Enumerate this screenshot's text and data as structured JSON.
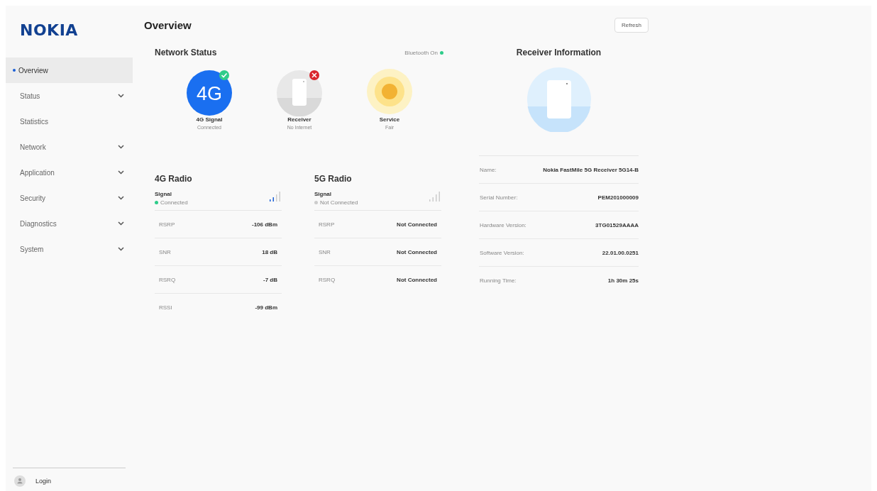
{
  "logo": "NOKIA",
  "sidebar": {
    "items": [
      {
        "label": "Overview",
        "selected": true,
        "expandable": false
      },
      {
        "label": "Status",
        "selected": false,
        "expandable": true
      },
      {
        "label": "Statistics",
        "selected": false,
        "expandable": false
      },
      {
        "label": "Network",
        "selected": false,
        "expandable": true
      },
      {
        "label": "Application",
        "selected": false,
        "expandable": true
      },
      {
        "label": "Security",
        "selected": false,
        "expandable": true
      },
      {
        "label": "Diagnostics",
        "selected": false,
        "expandable": true
      },
      {
        "label": "System",
        "selected": false,
        "expandable": true
      }
    ],
    "login": "Login"
  },
  "page_title": "Overview",
  "refresh_button": "Refresh",
  "network_status": {
    "title": "Network Status",
    "bluetooth": {
      "label": "Bluetooth On",
      "on": true
    },
    "items": [
      {
        "kind": "signal",
        "icon_text": "4G",
        "status_ok": true,
        "label": "4G Signal",
        "status": "Connected"
      },
      {
        "kind": "receiver",
        "status_ok": false,
        "label": "Receiver",
        "status": "No Internet"
      },
      {
        "kind": "service",
        "label": "Service",
        "status": "Fair"
      }
    ]
  },
  "radios": [
    {
      "title": "4G Radio",
      "signal_label": "Signal",
      "connected": true,
      "status": "Connected",
      "rows": [
        {
          "name": "RSRP",
          "value": "-106 dBm"
        },
        {
          "name": "SNR",
          "value": "18 dB"
        },
        {
          "name": "RSRQ",
          "value": "-7 dB"
        },
        {
          "name": "RSSI",
          "value": "-99 dBm"
        }
      ]
    },
    {
      "title": "5G Radio",
      "signal_label": "Signal",
      "connected": false,
      "status": "Not Connected",
      "rows": [
        {
          "name": "RSRP",
          "value": "Not Connected"
        },
        {
          "name": "SNR",
          "value": "Not Connected"
        },
        {
          "name": "RSRQ",
          "value": "Not Connected"
        }
      ]
    }
  ],
  "receiver_info": {
    "title": "Receiver Information",
    "rows": [
      {
        "name": "Name:",
        "value": "Nokia FastMile 5G Receiver 5G14-B"
      },
      {
        "name": "Serial Number:",
        "value": "PEM201000009"
      },
      {
        "name": "Hardware Version:",
        "value": "3TG01529AAAA"
      },
      {
        "name": "Software Version:",
        "value": "22.01.00.0251"
      },
      {
        "name": "Running Time:",
        "value": "1h 30m 25s"
      }
    ]
  }
}
